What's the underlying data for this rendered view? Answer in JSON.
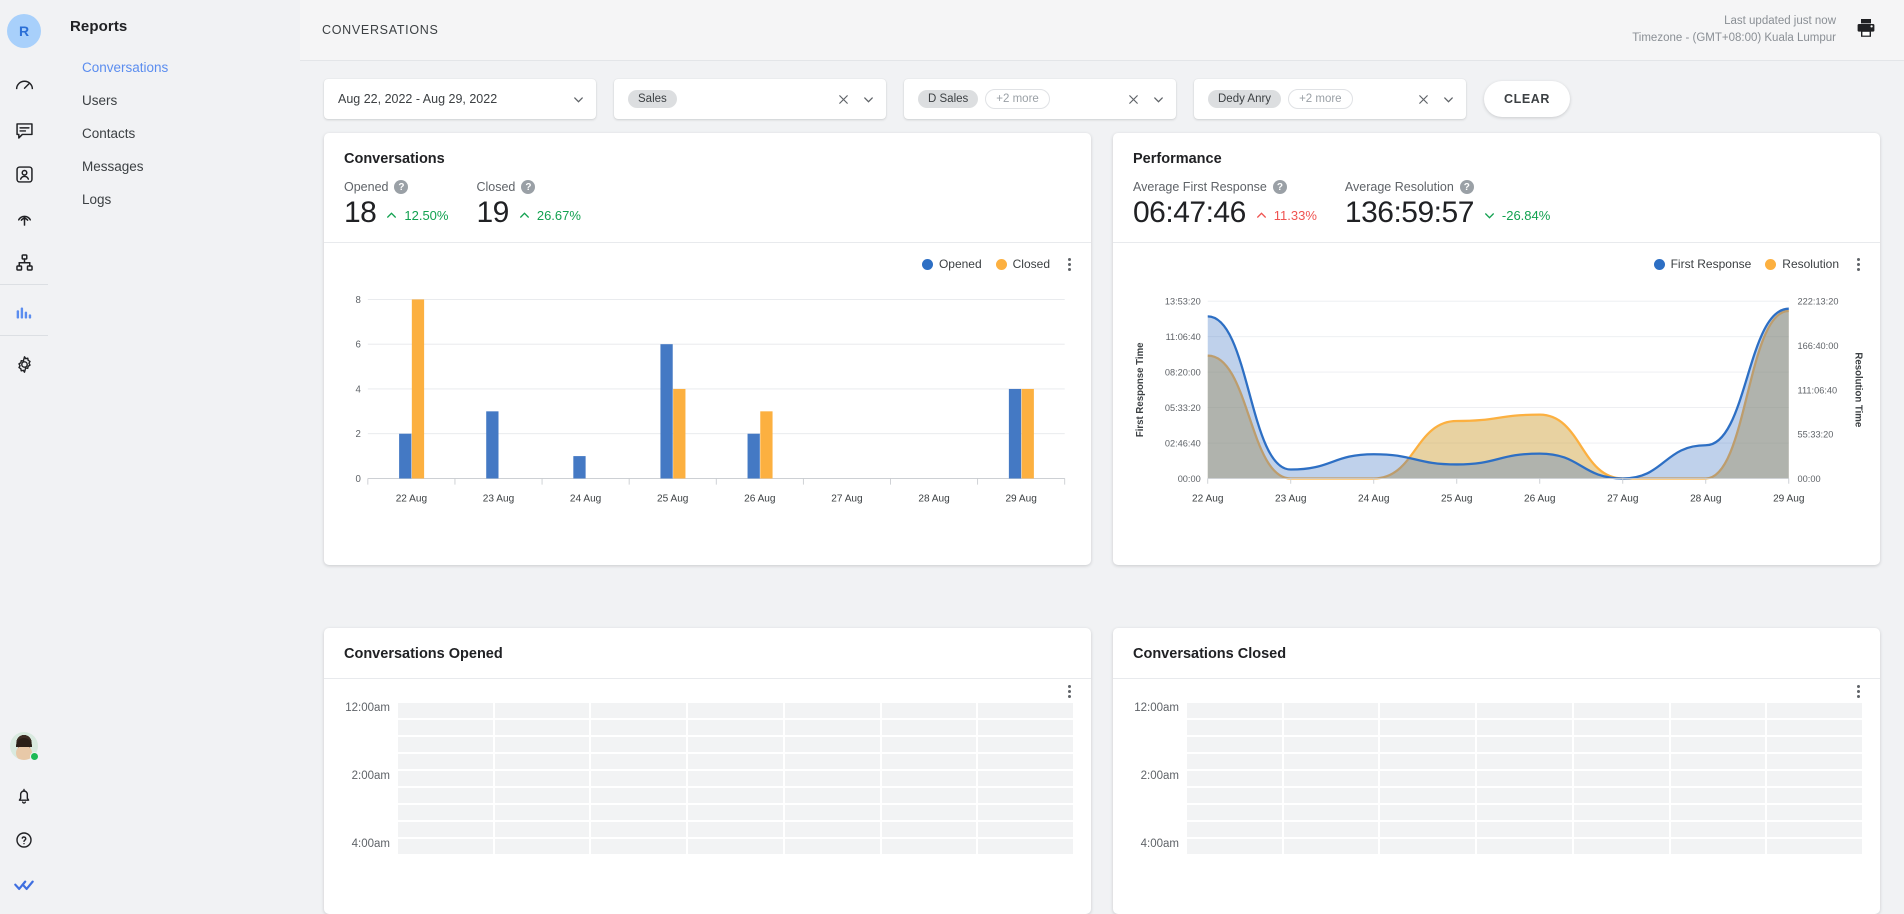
{
  "rail": {
    "logo_initial": "R",
    "icons": [
      {
        "name": "dashboard-gauge-icon",
        "label": "Dashboard"
      },
      {
        "name": "conversations-chat-icon",
        "label": "Conversations"
      },
      {
        "name": "contacts-person-icon",
        "label": "Contacts"
      },
      {
        "name": "broadcast-icon",
        "label": "Broadcast"
      },
      {
        "name": "workflow-icon",
        "label": "Workflow"
      },
      {
        "name": "reports-bar-icon",
        "label": "Reports"
      },
      {
        "name": "settings-gear-icon",
        "label": "Settings"
      }
    ],
    "bottom": [
      {
        "name": "notifications-bell-icon",
        "label": "Notifications"
      },
      {
        "name": "help-question-icon",
        "label": "Help"
      },
      {
        "name": "double-check-icon",
        "label": "Done"
      }
    ]
  },
  "sidebar": {
    "title": "Reports",
    "items": [
      {
        "label": "Conversations",
        "active": true
      },
      {
        "label": "Users",
        "active": false
      },
      {
        "label": "Contacts",
        "active": false
      },
      {
        "label": "Messages",
        "active": false
      },
      {
        "label": "Logs",
        "active": false
      }
    ]
  },
  "topbar": {
    "breadcrumb": "CONVERSATIONS",
    "last_updated": "Last updated just now",
    "timezone": "Timezone - (GMT+08:00) Kuala Lumpur",
    "print_icon": "printer-icon"
  },
  "filters": {
    "date_range": "Aug 22, 2022 - Aug 29, 2022",
    "channel": {
      "chips": [
        "Sales"
      ],
      "more": ""
    },
    "team": {
      "chips": [
        "D Sales"
      ],
      "more": "+2 more"
    },
    "agent": {
      "chips": [
        "Dedy Anry"
      ],
      "more": "+2 more"
    },
    "clear_label": "CLEAR"
  },
  "colors": {
    "blue": "#4479c4",
    "orange": "#fcb040",
    "green": "#12a150",
    "red": "#ef5350",
    "accent": "#5b8def"
  },
  "conversations_card": {
    "title": "Conversations",
    "stats": [
      {
        "label": "Opened",
        "value": "18",
        "delta": "12.50%",
        "direction": "up",
        "tone": "green"
      },
      {
        "label": "Closed",
        "value": "19",
        "delta": "26.67%",
        "direction": "up",
        "tone": "green"
      }
    ]
  },
  "performance_card": {
    "title": "Performance",
    "stats": [
      {
        "label": "Average First Response",
        "value": "06:47:46",
        "delta": "11.33%",
        "direction": "up",
        "tone": "red"
      },
      {
        "label": "Average Resolution",
        "value": "136:59:57",
        "delta": "-26.84%",
        "direction": "down",
        "tone": "green"
      }
    ]
  },
  "opened_heat_card": {
    "title": "Conversations Opened",
    "row_labels": [
      "12:00am",
      "",
      "2:00am",
      "",
      "4:00am"
    ]
  },
  "closed_heat_card": {
    "title": "Conversations Closed",
    "row_labels": [
      "12:00am",
      "",
      "2:00am",
      "",
      "4:00am"
    ]
  },
  "chart_data": [
    {
      "type": "bar",
      "title": "Conversations",
      "categories": [
        "22 Aug",
        "23 Aug",
        "24 Aug",
        "25 Aug",
        "26 Aug",
        "27 Aug",
        "28 Aug",
        "29 Aug"
      ],
      "series": [
        {
          "name": "Opened",
          "color": "#4479c4",
          "values": [
            2,
            3,
            1,
            6,
            2,
            0,
            0,
            4
          ]
        },
        {
          "name": "Closed",
          "color": "#fcb040",
          "values": [
            8,
            0,
            0,
            4,
            3,
            0,
            0,
            4
          ]
        }
      ],
      "ylabel": "",
      "xlabel": "",
      "yticks": [
        0,
        2,
        4,
        6,
        8
      ],
      "ylim": [
        0,
        8
      ],
      "grid": true,
      "legend": "top-right"
    },
    {
      "type": "area",
      "title": "Performance",
      "categories": [
        "22 Aug",
        "23 Aug",
        "24 Aug",
        "25 Aug",
        "26 Aug",
        "27 Aug",
        "28 Aug",
        "29 Aug"
      ],
      "ylabel": "First Response Time",
      "y2label": "Resolution Time",
      "yticks": [
        "00:00",
        "02:46:40",
        "05:33:20",
        "08:20:00",
        "11:06:40",
        "13:53:20"
      ],
      "y2ticks": [
        "00:00",
        "55:33:20",
        "111:06:40",
        "166:40:00",
        "222:13:20"
      ],
      "series": [
        {
          "name": "First Response",
          "color": "#4479c4",
          "values": [
            12.7,
            0.7,
            1.9,
            1.1,
            1.95,
            0.0,
            2.6,
            13.3
          ],
          "unit": "hours",
          "ymax": 13.888
        },
        {
          "name": "Resolution",
          "color": "#fcb040",
          "values": [
            154,
            0,
            0,
            72,
            80,
            0,
            0,
            210
          ],
          "unit": "hours",
          "ymax": 222.22
        }
      ],
      "grid": true,
      "legend": "top-right"
    }
  ]
}
